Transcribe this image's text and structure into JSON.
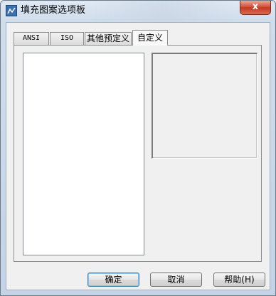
{
  "window": {
    "title": "填充图案选项板",
    "close_glyph": "x",
    "app_icon": "hatch-pattern-icon"
  },
  "tabs": [
    {
      "label": "ANSI",
      "active": false
    },
    {
      "label": "ISO",
      "active": false
    },
    {
      "label": "其他预定义",
      "active": false
    },
    {
      "label": "自定义",
      "active": true
    }
  ],
  "buttons": {
    "ok": "确定",
    "cancel": "取消",
    "help": "帮助(H)"
  },
  "colors": {
    "accent": "#3c7fb1",
    "close": "#c23a22"
  }
}
